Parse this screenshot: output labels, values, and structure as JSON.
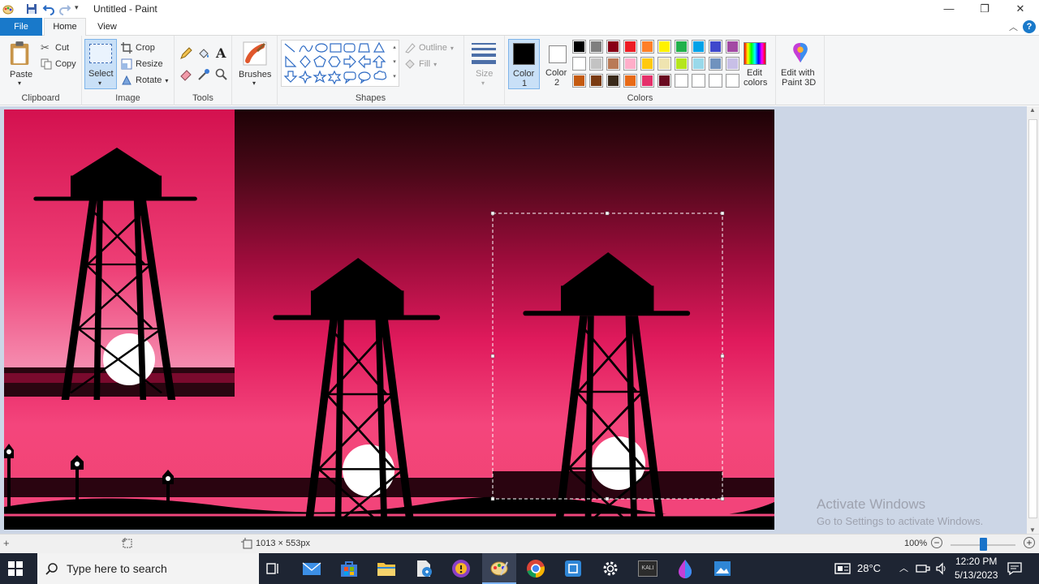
{
  "window": {
    "title": "Untitled - Paint"
  },
  "tabs": {
    "file": "File",
    "home": "Home",
    "view": "View"
  },
  "clipboard": {
    "paste": "Paste",
    "cut": "Cut",
    "copy": "Copy",
    "label": "Clipboard"
  },
  "image": {
    "select": "Select",
    "crop": "Crop",
    "resize": "Resize",
    "rotate": "Rotate",
    "label": "Image"
  },
  "tools": {
    "label": "Tools"
  },
  "brushes": {
    "label": "Brushes"
  },
  "shapes": {
    "outline": "Outline",
    "fill": "Fill",
    "label": "Shapes"
  },
  "size": {
    "label": "Size"
  },
  "colors": {
    "color1": "Color",
    "color1_num": "1",
    "color2": "Color",
    "color2_num": "2",
    "edit_colors": "Edit",
    "edit_colors2": "colors",
    "label": "Colors",
    "palette_row1": [
      "#000000",
      "#7f7f7f",
      "#880015",
      "#ed1c24",
      "#ff7f27",
      "#fff200",
      "#22b14c",
      "#00a2e8",
      "#3f48cc",
      "#a349a4"
    ],
    "palette_row2": [
      "#ffffff",
      "#c3c3c3",
      "#b97a57",
      "#ffaec9",
      "#ffc90e",
      "#efe4b0",
      "#b5e61d",
      "#99d9ea",
      "#7092be",
      "#c8bfe7"
    ],
    "palette_row3": [
      "#c45a10",
      "#7a3b12",
      "#3a2a1a",
      "#e86a16",
      "#e5306a",
      "#6a0a20",
      "#ffffff",
      "#ffffff",
      "#ffffff",
      "#ffffff"
    ]
  },
  "paint3d": {
    "line1": "Edit with",
    "line2": "Paint 3D"
  },
  "status": {
    "dimensions": "1013 × 553px",
    "zoom": "100%"
  },
  "watermark": {
    "title": "Activate Windows",
    "subtitle": "Go to Settings to activate Windows."
  },
  "taskbar": {
    "search_placeholder": "Type here to search",
    "temperature": "28°C",
    "time": "12:20 PM",
    "date": "5/13/2023",
    "kali_label": "KALI"
  }
}
